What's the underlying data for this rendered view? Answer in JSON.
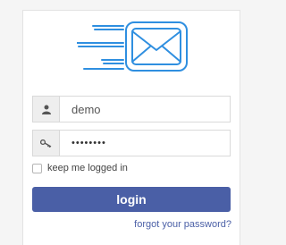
{
  "logo": {
    "icon": "envelope-speed-icon",
    "color": "#2f8fe0"
  },
  "username": {
    "value": "demo",
    "icon": "user-icon"
  },
  "password": {
    "masked_value": "••••••••",
    "icon": "key-icon"
  },
  "remember_me": {
    "label": "keep me logged in",
    "checked": false
  },
  "login_button": {
    "label": "login",
    "color": "#4a5fa6"
  },
  "forgot_password": {
    "label": "forgot your password?"
  }
}
